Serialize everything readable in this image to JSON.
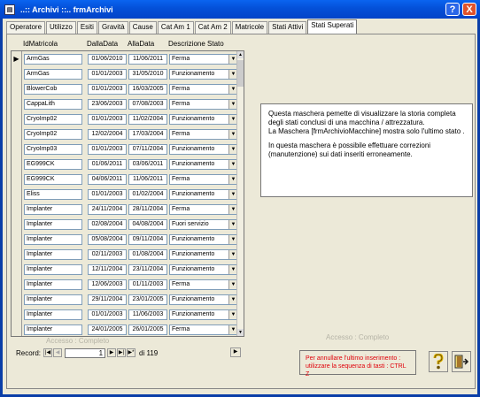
{
  "window": {
    "title": "..:: Archivi ::..   frmArchivi",
    "help_label": "?",
    "close_label": "X"
  },
  "tabs": [
    "Operatore",
    "Utilizzo",
    "Esiti",
    "Gravità",
    "Cause",
    "Cat Am 1",
    "Cat Am 2",
    "Matricole",
    "Stati Attivi",
    "Stati Superati"
  ],
  "active_tab": "Stati Superati",
  "columns": [
    "IdMatricola",
    "DallaData",
    "AllaData",
    "Descrizione Stato"
  ],
  "rows": [
    [
      "ArmGas",
      "01/06/2010",
      "11/06/2011",
      "Ferma"
    ],
    [
      "ArmGas",
      "01/01/2003",
      "31/05/2010",
      "Funzionamento"
    ],
    [
      "BlowerCob",
      "01/01/2003",
      "16/03/2005",
      "Ferma"
    ],
    [
      "CappaLith",
      "23/06/2003",
      "07/08/2003",
      "Ferma"
    ],
    [
      "CryoImp02",
      "01/01/2003",
      "11/02/2004",
      "Funzionamento"
    ],
    [
      "CryoImp02",
      "12/02/2004",
      "17/03/2004",
      "Ferma"
    ],
    [
      "CryoImp03",
      "01/01/2003",
      "07/11/2004",
      "Funzionamento"
    ],
    [
      "EG999CK",
      "01/06/2011",
      "03/06/2011",
      "Funzionamento"
    ],
    [
      "EG999CK",
      "04/06/2011",
      "11/06/2011",
      "Ferma"
    ],
    [
      "Eliss",
      "01/01/2003",
      "01/02/2004",
      "Funzionamento"
    ],
    [
      "Implanter",
      "24/11/2004",
      "28/11/2004",
      "Ferma"
    ],
    [
      "Implanter",
      "02/08/2004",
      "04/08/2004",
      "Fuori servizio"
    ],
    [
      "Implanter",
      "05/08/2004",
      "09/11/2004",
      "Funzionamento"
    ],
    [
      "Implanter",
      "02/11/2003",
      "01/08/2004",
      "Funzionamento"
    ],
    [
      "Implanter",
      "12/11/2004",
      "23/11/2004",
      "Funzionamento"
    ],
    [
      "Implanter",
      "12/06/2003",
      "01/11/2003",
      "Ferma"
    ],
    [
      "Implanter",
      "29/11/2004",
      "23/01/2005",
      "Funzionamento"
    ],
    [
      "Implanter",
      "01/01/2003",
      "11/06/2003",
      "Funzionamento"
    ],
    [
      "Implanter",
      "24/01/2005",
      "26/01/2005",
      "Ferma"
    ]
  ],
  "accesso": "Accesso : Completo",
  "nav": {
    "label": "Record:",
    "current": "1",
    "total": "di 119"
  },
  "info": {
    "p1_line1": "Questa maschera pemette di visualizzare la storia completa",
    "p1_line2": "degli stati conclusi di una macchina / attrezzatura.",
    "p1_line3": "La Maschera [frmArchivioMacchine] mostra solo l'ultimo stato .",
    "p2_line1": "In questa maschera è possibile effettuare correzioni",
    "p2_line2": "(manutenzione) sui dati inseriti erroneamente."
  },
  "undo_hint": {
    "line1": "Per annullare l'ultimo inserimento :",
    "line2": "utilizzare la sequenza di tasti :   CTRL  Z"
  },
  "icons": {
    "help": "question-mark-icon",
    "exit": "exit-door-icon"
  }
}
